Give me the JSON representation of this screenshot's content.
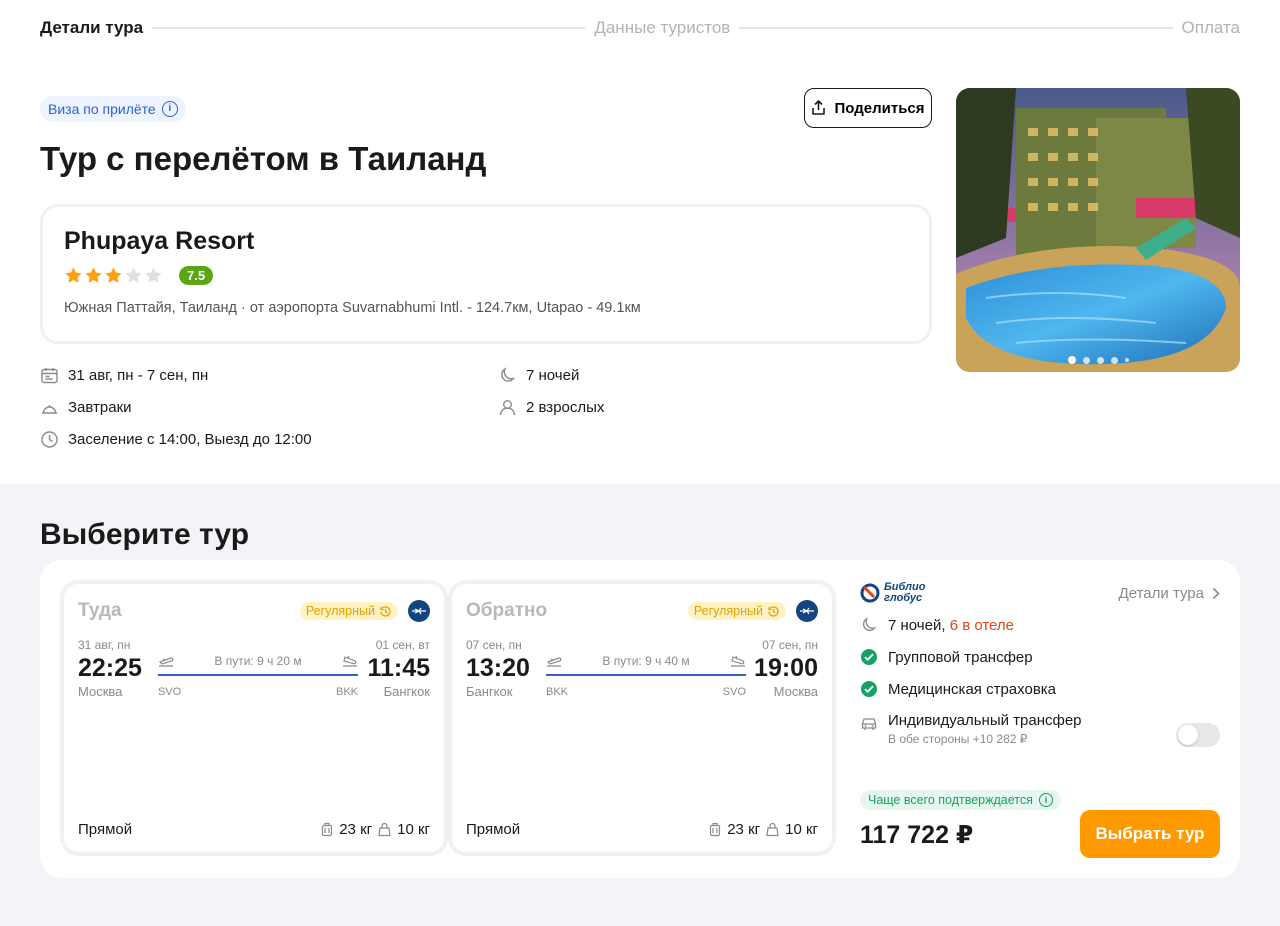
{
  "stepper": {
    "steps": [
      "Детали тура",
      "Данные туристов",
      "Оплата"
    ]
  },
  "header": {
    "visa_badge": "Виза по прилёте",
    "share_label": "Поделиться",
    "title": "Тур с перелётом в Таиланд"
  },
  "hotel": {
    "name": "Phupaya Resort",
    "stars": 3,
    "max_stars": 5,
    "rating": "7.5",
    "location": "Южная Паттайя, Таиланд · от аэропорта Suvarnabhumi Intl. - 124.7км, Utapao - 49.1км"
  },
  "facts": {
    "dates": "31 авг, пн - 7 сен, пн",
    "nights": "7 ночей",
    "meals": "Завтраки",
    "guests": "2 взрослых",
    "checkin": "Заселение с 14:00, Выезд до 12:00"
  },
  "gallery": {
    "slides": 5,
    "active_slide": 1
  },
  "select": {
    "title": "Выберите тур"
  },
  "flights": [
    {
      "direction": "Туда",
      "tag": "Регулярный",
      "dep_date": "31 авг, пн",
      "dep_time": "22:25",
      "dep_city": "Москва",
      "dep_code": "SVO",
      "arr_date": "01 сен, вт",
      "arr_time": "11:45",
      "arr_city": "Бангкок",
      "arr_code": "BKK",
      "duration": "В пути: 9 ч 20 м",
      "type": "Прямой",
      "luggage": "23 кг",
      "hand_luggage": "10 кг"
    },
    {
      "direction": "Обратно",
      "tag": "Регулярный",
      "dep_date": "07 сен, пн",
      "dep_time": "13:20",
      "dep_city": "Бангкок",
      "dep_code": "BKK",
      "arr_date": "07 сен, пн",
      "arr_time": "19:00",
      "arr_city": "Москва",
      "arr_code": "SVO",
      "duration": "В пути: 9 ч 40 м",
      "type": "Прямой",
      "luggage": "23 кг",
      "hand_luggage": "10 кг"
    }
  ],
  "offer": {
    "operator_line1": "Библио",
    "operator_line2": "глобус",
    "details_link": "Детали тура",
    "nights": "7 ночей,",
    "nights_hotel": "6 в отеле",
    "included": [
      "Групповой трансфер",
      "Медицинская страховка"
    ],
    "transfer_option": "Индивидуальный трансфер",
    "transfer_sub": "В обе стороны +10 282 ₽",
    "transfer_enabled": false,
    "confirm_badge": "Чаще всего подтверждается",
    "price": "117 722 ₽",
    "select_button": "Выбрать тур"
  },
  "colors": {
    "accent": "#ff9900",
    "route_line": "#3a5cc7",
    "rating": "#5aa615",
    "star": "#ff9f0a",
    "star_empty": "#e0e0e0",
    "included_check": "#19a163",
    "warning_text": "#e2451a"
  }
}
